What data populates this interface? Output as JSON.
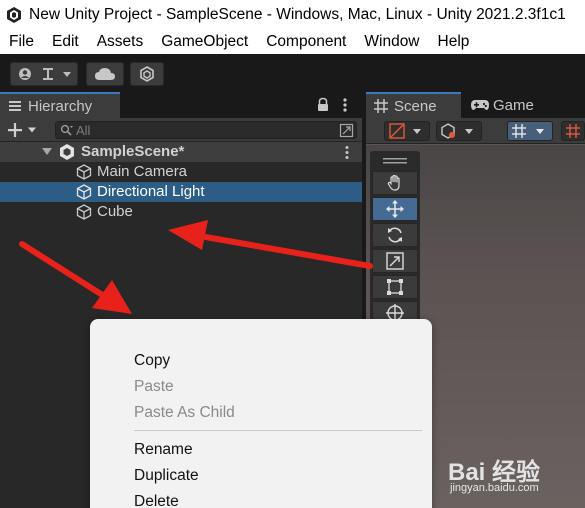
{
  "window": {
    "title": "New Unity Project - SampleScene - Windows, Mac, Linux - Unity 2021.2.3f1c1"
  },
  "menubar": {
    "items": [
      "File",
      "Edit",
      "Assets",
      "GameObject",
      "Component",
      "Window",
      "Help"
    ]
  },
  "toolbar": {
    "icons": [
      "account-icon",
      "layers-dropdown-icon",
      "cloud-icon",
      "collab-icon"
    ]
  },
  "hierarchy": {
    "tab_label": "Hierarchy",
    "search_placeholder": "All",
    "scene_name": "SampleScene*",
    "items": [
      {
        "label": "Main Camera",
        "selected": false
      },
      {
        "label": "Directional Light",
        "selected": true
      },
      {
        "label": "Cube",
        "selected": false
      }
    ]
  },
  "scene_view": {
    "tabs": [
      {
        "label": "Scene",
        "active": true
      },
      {
        "label": "Game",
        "active": false
      }
    ],
    "tools": [
      "hand-tool",
      "move-tool",
      "rotate-tool",
      "scale-tool",
      "rect-tool",
      "transform-tool"
    ],
    "active_tool": "move-tool"
  },
  "context_menu": {
    "items": [
      {
        "label": "Copy",
        "enabled": true
      },
      {
        "label": "Paste",
        "enabled": false
      },
      {
        "label": "Paste As Child",
        "enabled": false
      },
      {
        "label": "Rename",
        "enabled": true
      },
      {
        "label": "Duplicate",
        "enabled": true
      },
      {
        "label": "Delete",
        "enabled": true
      }
    ]
  },
  "annotations": {
    "arrow_color": "#e8211b"
  },
  "watermark": {
    "main": "Bai 经验",
    "sub": "jingyan.baidu.com"
  },
  "colors": {
    "selection": "#2c5d87",
    "panel_bg": "#282828",
    "accent": "#3a79bb"
  }
}
